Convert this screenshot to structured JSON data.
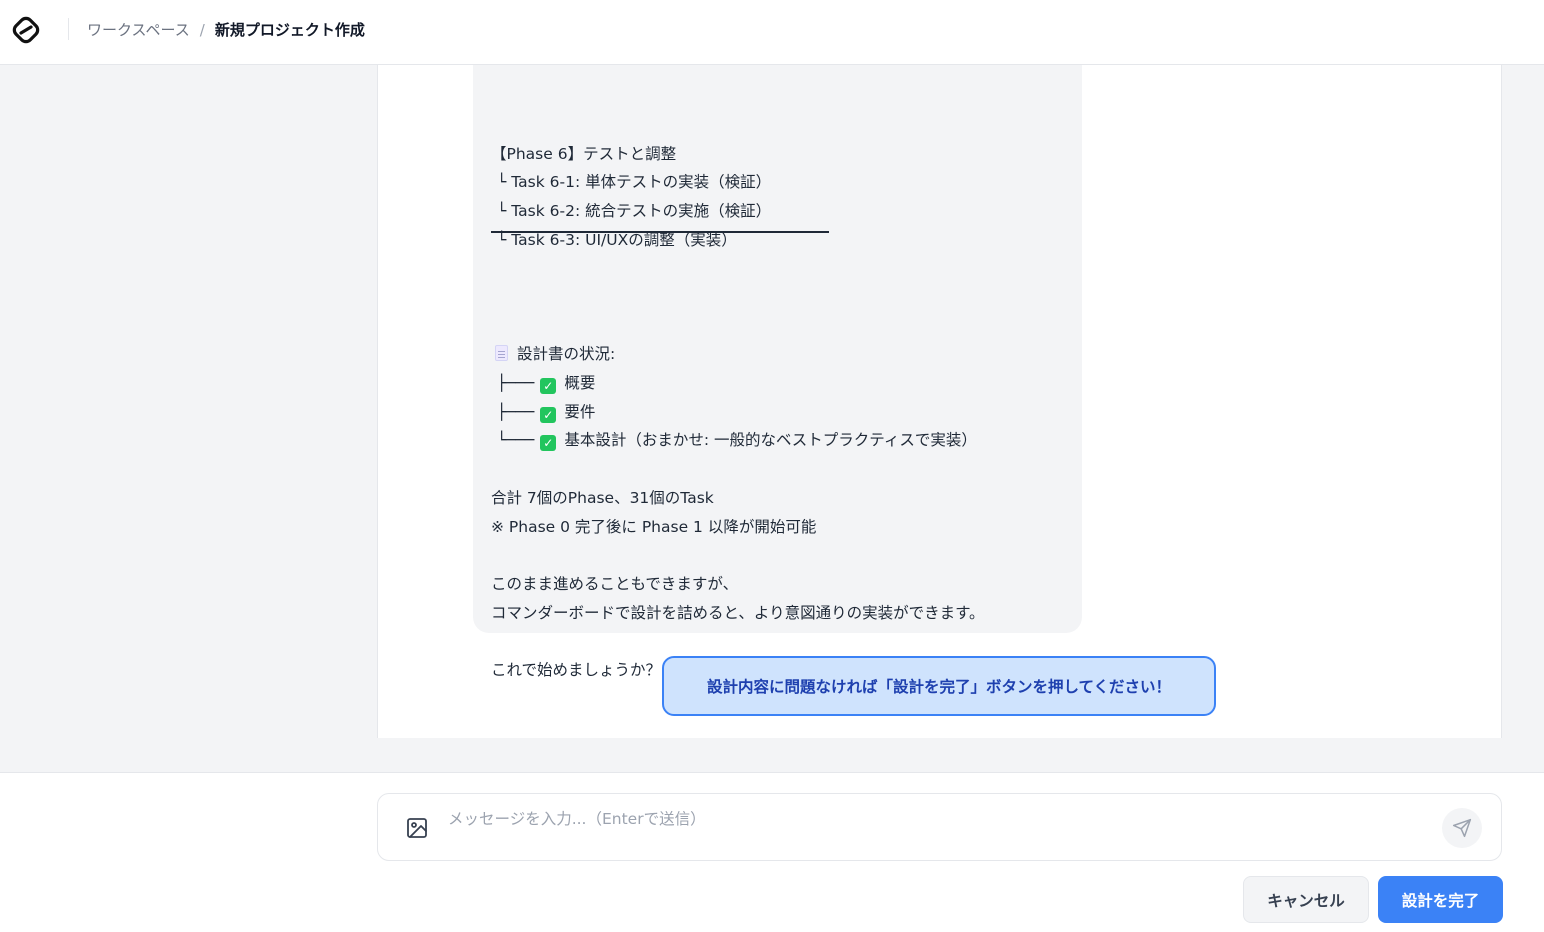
{
  "header": {
    "breadcrumb_parent": "ワークスペース",
    "breadcrumb_separator": "/",
    "breadcrumb_current": "新規プロジェクト作成"
  },
  "message": {
    "phase6_title": "【Phase 6】テストと調整",
    "tasks": [
      "└ Task 6-1: 単体テストの実装（検証）",
      "└ Task 6-2: 統合テストの実施（検証）",
      "└ Task 6-3: UI/UXの調整（実装）"
    ],
    "doc_status_label": "設計書の状況:",
    "doc_items": [
      {
        "prefix": "├───",
        "label": "概要"
      },
      {
        "prefix": "├───",
        "label": "要件"
      },
      {
        "prefix": "└───",
        "label": "基本設計（おまかせ: 一般的なベストプラクティスで実装）"
      }
    ],
    "total": "合計 7個のPhase、31個のTask",
    "note": "※ Phase 0 完了後に Phase 1 以降が開始可能",
    "proceed_1": "このまま進めることもできますが、",
    "proceed_2": "コマンダーボードで設計を詰めると、より意図通りの実装ができます。",
    "question": "これで始めましょうか？"
  },
  "notice": "設計内容に問題なければ「設計を完了」ボタンを押してください！",
  "composer": {
    "placeholder": "メッセージを入力...（Enterで送信）",
    "value": ""
  },
  "actions": {
    "cancel_label": "キャンセル",
    "finish_label": "設計を完了"
  },
  "colors": {
    "accent": "#3b82f6",
    "notice_bg": "#cfe3fd",
    "check": "#22c55e"
  }
}
